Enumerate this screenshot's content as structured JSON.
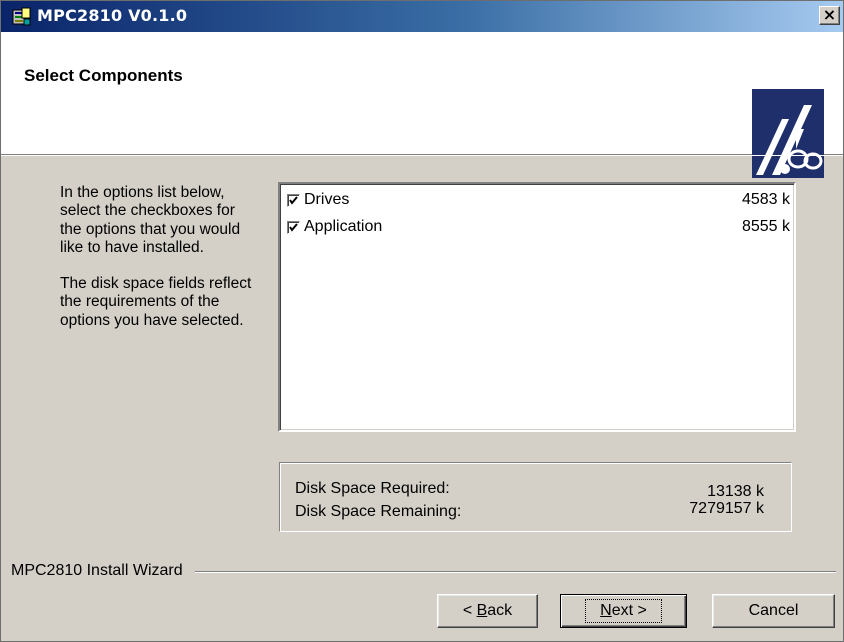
{
  "window": {
    "title": "MPC2810 V0.1.0",
    "close_label": "×"
  },
  "header": {
    "title": "Select Components"
  },
  "description": {
    "paragraph1": "In the options list below, select the checkboxes for the options that you would like to have installed.",
    "paragraph2": "The disk space fields reflect the requirements of the options you have selected."
  },
  "components": [
    {
      "label": "Drives",
      "size": "4583 k",
      "checked": true
    },
    {
      "label": "Application",
      "size": "8555 k",
      "checked": true
    }
  ],
  "disk_space": {
    "required_label": "Disk Space Required:",
    "required_value": "13138 k",
    "remaining_label": "Disk Space Remaining:",
    "remaining_value": "7279157 k"
  },
  "footer": {
    "wizard_label": "MPC2810 Install Wizard",
    "back_prefix": "< ",
    "back_mnemonic": "B",
    "back_rest": "ack",
    "next_mnemonic": "N",
    "next_rest": "ext >",
    "cancel_label": "Cancel"
  },
  "colors": {
    "titlebar_start": "#0a246a",
    "titlebar_end": "#a6caf0",
    "face": "#d4d0c8",
    "logo_bg": "#1f2f6b"
  }
}
